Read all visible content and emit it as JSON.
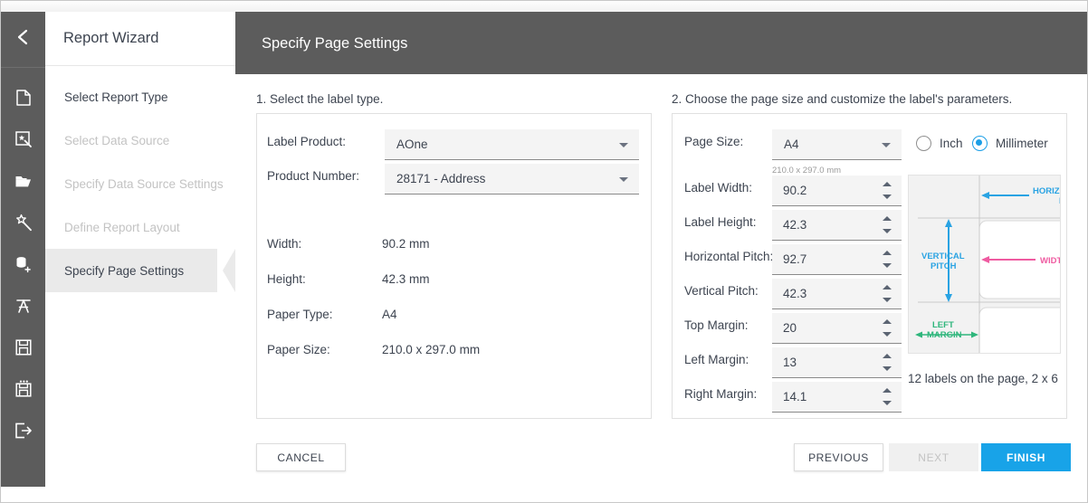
{
  "window": {
    "title_bar": ""
  },
  "rail": {
    "back_icon": "chevron-left-icon",
    "items": [
      {
        "icon": "new-document-icon",
        "name": "new-report"
      },
      {
        "icon": "report-wizard-icon",
        "name": "report-wizard"
      },
      {
        "icon": "open-folder-icon",
        "name": "open-report"
      },
      {
        "icon": "magic-wand-icon",
        "name": "design-wizard"
      },
      {
        "icon": "database-add-icon",
        "name": "add-data-source"
      },
      {
        "icon": "text-character-icon",
        "name": "text-tool"
      },
      {
        "icon": "save-icon",
        "name": "save"
      },
      {
        "icon": "save-as-icon",
        "name": "save-as"
      },
      {
        "icon": "exit-icon",
        "name": "exit"
      }
    ]
  },
  "wizard": {
    "title": "Report Wizard",
    "steps": [
      {
        "label": "Select Report Type",
        "state": "done"
      },
      {
        "label": "Select Data Source",
        "state": "disabled"
      },
      {
        "label": "Specify Data Source Settings",
        "state": "disabled"
      },
      {
        "label": "Define Report Layout",
        "state": "disabled"
      },
      {
        "label": "Specify Page Settings",
        "state": "active"
      }
    ]
  },
  "header": {
    "title": "Specify Page Settings"
  },
  "section1": {
    "title": "1. Select the label type.",
    "label_product_label": "Label Product:",
    "label_product_value": "AOne",
    "product_number_label": "Product Number:",
    "product_number_value": "28171 - Address",
    "details": [
      {
        "label": "Width:",
        "value": "90.2 mm"
      },
      {
        "label": "Height:",
        "value": "42.3 mm"
      },
      {
        "label": "Paper Type:",
        "value": "A4"
      },
      {
        "label": "Paper Size:",
        "value": "210.0 x 297.0 mm"
      }
    ]
  },
  "section2": {
    "title": "2. Choose the page size and customize the label's parameters.",
    "page_size_label": "Page Size:",
    "page_size_value": "A4",
    "page_size_hint": "210.0 x 297.0 mm",
    "units": [
      {
        "label": "Inch",
        "selected": false
      },
      {
        "label": "Millimeter",
        "selected": true
      }
    ],
    "fields": [
      {
        "label": "Label Width:",
        "value": "90.2"
      },
      {
        "label": "Label Height:",
        "value": "42.3"
      },
      {
        "label": "Horizontal Pitch:",
        "value": "92.7"
      },
      {
        "label": "Vertical Pitch:",
        "value": "42.3"
      },
      {
        "label": "Top Margin:",
        "value": "20"
      },
      {
        "label": "Left Margin:",
        "value": "13"
      },
      {
        "label": "Right Margin:",
        "value": "14.1"
      }
    ],
    "diagram": {
      "horizontal_pitch_label": "HORIZONTAL PITCH",
      "vertical_pitch_label": "VERTICAL PITCH",
      "width_label": "WIDTH",
      "left_margin_label": "LEFT MARGIN",
      "pitch_color": "#29a3e3",
      "width_color": "#ef5ba1",
      "margin_color": "#2fb67c"
    },
    "summary": "12 labels on the page, 2 x 6"
  },
  "footer": {
    "cancel": "CANCEL",
    "previous": "PREVIOUS",
    "next": "NEXT",
    "finish": "FINISH"
  }
}
